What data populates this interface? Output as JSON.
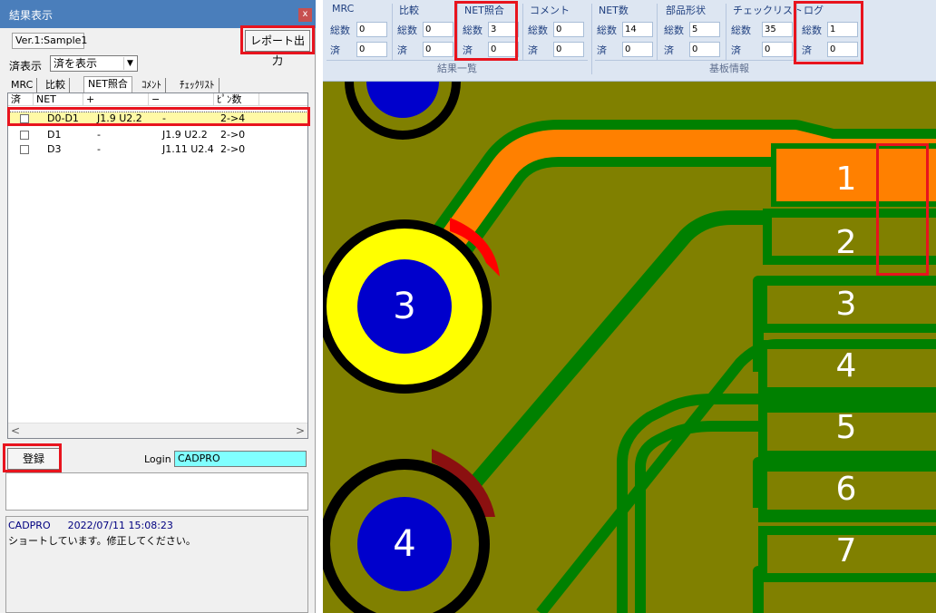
{
  "window": {
    "title": "結果表示",
    "close": "x"
  },
  "version": "Ver.1:Sample1",
  "report_button": "レポート出力",
  "filter": {
    "label": "済表示",
    "value": "済を表示"
  },
  "tabs": [
    "MRC",
    "比較",
    "NET照合",
    "ｺﾒﾝﾄ",
    "ﾁｪｯｸﾘｽﾄ"
  ],
  "active_tab": "NET照合",
  "list": {
    "headers": [
      "済",
      "NET",
      "+",
      "−",
      "ﾋﾟﾝ数"
    ],
    "rows": [
      {
        "net": "D0-D1",
        "plus": "J1.9 U2.2",
        "minus": "-",
        "pins": "2->4",
        "selected": true
      },
      {
        "net": "D1",
        "plus": "-",
        "minus": "J1.9 U2.2",
        "pins": "2->0",
        "selected": false
      },
      {
        "net": "D3",
        "plus": "-",
        "minus": "J1.11 U2.4",
        "pins": "2->0",
        "selected": false
      }
    ]
  },
  "register_button": "登録",
  "login": {
    "label": "Login",
    "value": "CADPRO"
  },
  "log": {
    "user": "CADPRO",
    "datetime": "2022/07/11 15:08:23",
    "message": "ショートしています。修正してください。"
  },
  "ribbon": {
    "result_group_label": "結果一覧",
    "board_group_label": "基板情報",
    "total_label": "総数",
    "done_label": "済",
    "sections": [
      {
        "title": "MRC",
        "total": "0",
        "done": "0"
      },
      {
        "title": "比較",
        "total": "0",
        "done": "0"
      },
      {
        "title": "NET照合",
        "total": "3",
        "done": "0"
      },
      {
        "title": "コメント",
        "total": "0",
        "done": "0"
      },
      {
        "title": "NET数",
        "total": "14",
        "done": "0"
      },
      {
        "title": "部品形状",
        "total": "5",
        "done": "0"
      },
      {
        "title": "チェックリスト",
        "total": "35",
        "done": "0"
      },
      {
        "title": "ログ",
        "total": "1",
        "done": "0"
      }
    ]
  },
  "pcb": {
    "pads": [
      "3",
      "4"
    ],
    "pins": [
      "1",
      "2",
      "3",
      "4",
      "5",
      "6",
      "7"
    ]
  },
  "colors": {
    "board": "#808000",
    "trace": "#008000",
    "short_trace": "#ff8000",
    "highlight": "#e8141e",
    "pad_ring": "#ffff00",
    "pad_center": "#0000cc"
  }
}
